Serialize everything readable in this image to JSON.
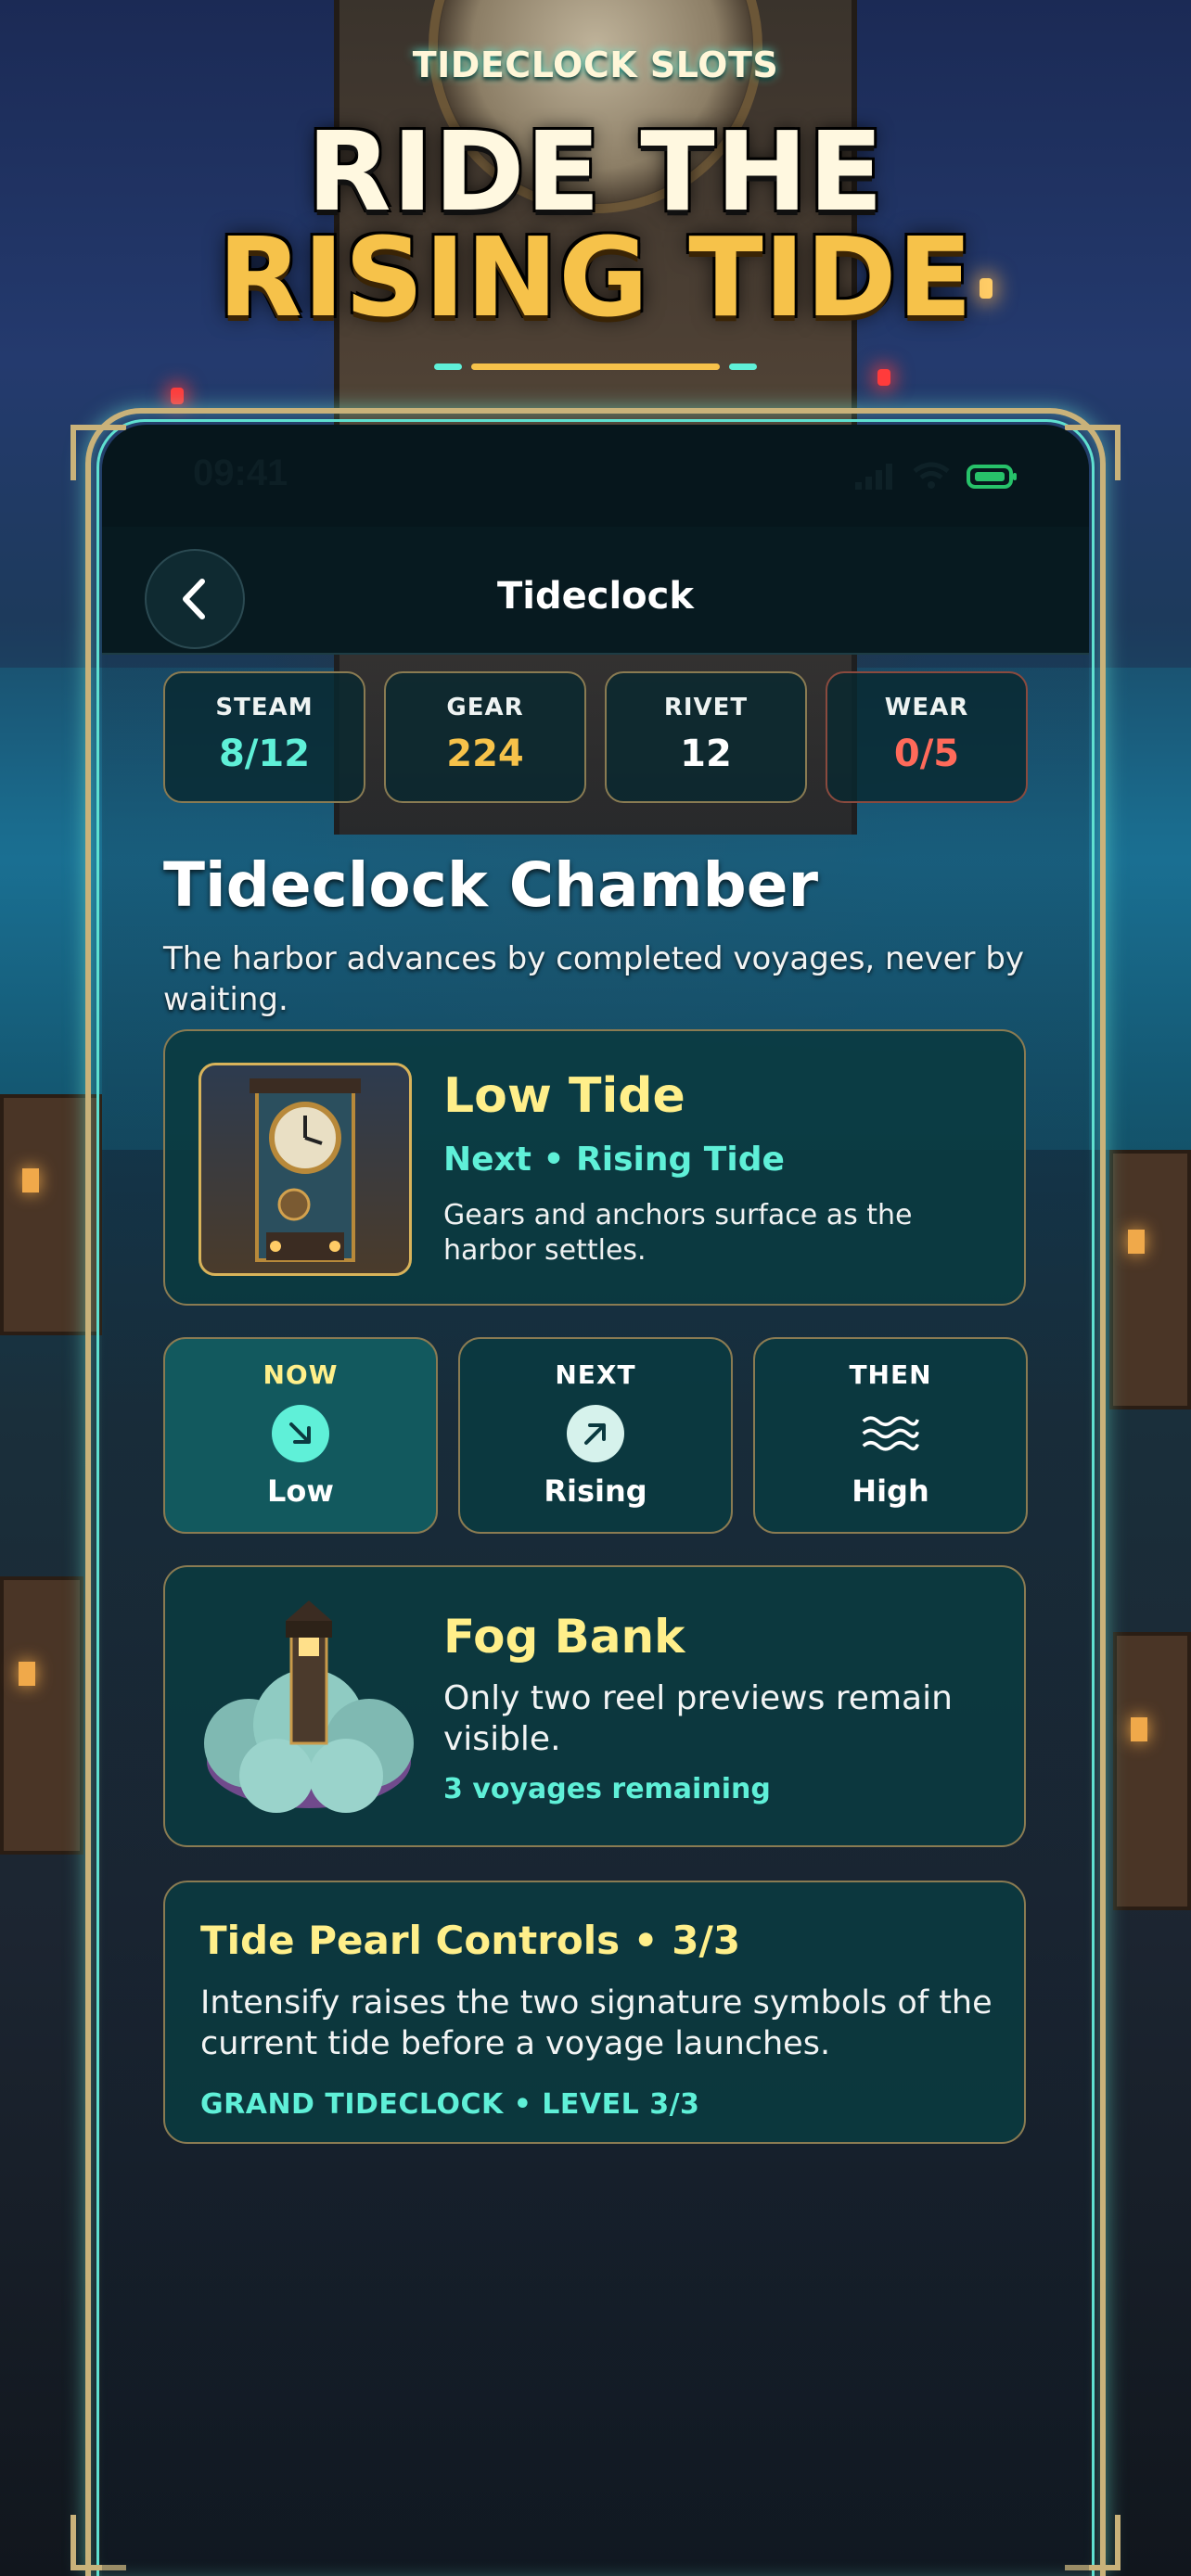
{
  "banner": {
    "brand": "TIDECLOCK SLOTS",
    "headline_line1": "RIDE THE",
    "headline_line2": "RISING TIDE"
  },
  "status_bar": {
    "time": "09:41",
    "icons": [
      "signal-icon",
      "wifi-icon",
      "battery-icon"
    ]
  },
  "nav": {
    "title": "Tideclock",
    "back_icon": "chevron-left-icon"
  },
  "stats": [
    {
      "label": "STEAM",
      "value": "8/12",
      "color": "#5ff0d8"
    },
    {
      "label": "GEAR",
      "value": "224",
      "color": "#f6c24a"
    },
    {
      "label": "RIVET",
      "value": "12",
      "color": "#ffffff"
    },
    {
      "label": "WEAR",
      "value": "0/5",
      "color": "#ff6a5a"
    }
  ],
  "chamber": {
    "title": "Tideclock Chamber",
    "subtitle": "The harbor advances by completed voyages, never by waiting."
  },
  "current_tide": {
    "name": "Low Tide",
    "next": "Next • Rising Tide",
    "description": "Gears and anchors surface as the harbor settles."
  },
  "phases": [
    {
      "label": "NOW",
      "name": "Low",
      "icon": "arrow-down-right-icon",
      "label_color": "#ffef8a"
    },
    {
      "label": "NEXT",
      "name": "Rising",
      "icon": "arrow-up-right-icon",
      "label_color": "#ffffff"
    },
    {
      "label": "THEN",
      "name": "High",
      "icon": "waves-icon",
      "label_color": "#ffffff"
    }
  ],
  "effect": {
    "name": "Fog Bank",
    "description": "Only two reel previews remain visible.",
    "remaining": "3 voyages remaining"
  },
  "controls": {
    "title": "Tide Pearl Controls • 3/3",
    "description": "Intensify raises the two signature symbols of the current tide before a voyage launches.",
    "level": "GRAND TIDECLOCK • LEVEL 3/3"
  },
  "colors": {
    "accent_teal": "#5ff0d8",
    "accent_gold": "#f6c24a",
    "card_border": "#8a7b52",
    "card_bg": "#0a3a40"
  }
}
